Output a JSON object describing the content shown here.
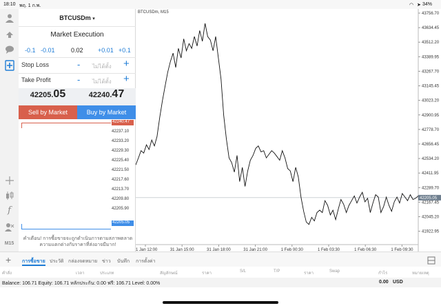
{
  "status_bar": {
    "time": "18:10",
    "date": "พฤ. 1 ก.พ.",
    "battery": "34%"
  },
  "toolbar": {
    "timeframe": "M15"
  },
  "order": {
    "symbol": "BTCUSDm",
    "symbol_caret": "▾",
    "execution": "Market Execution",
    "lot_steps": [
      "-0.1",
      "-0.01",
      "0.02",
      "+0.01",
      "+0.1"
    ],
    "stop_loss_label": "Stop Loss",
    "take_profit_label": "Take Profit",
    "not_set": "ไม่ได้ตั้ง",
    "minus": "-",
    "plus": "+",
    "bid_main": "42205.",
    "bid_big": "05",
    "ask_main": "42240.",
    "ask_big": "47",
    "sell_label": "Sell by Market",
    "buy_label": "Buy by Market",
    "ladder": [
      "42237.10",
      "42233.20",
      "42229.30",
      "42225.40",
      "42221.50",
      "42217.60",
      "42213.70",
      "42209.80",
      "42205.90"
    ],
    "ask_tag": "42240.47",
    "bid_tag": "42205.05",
    "warning_line1": "คำเตือน! การซื้อขายจะถูกดำเนินการตามสภาพตลาด",
    "warning_line2": "ความแตกต่างกับราคาที่ส่งอาจมีมาก!"
  },
  "chart_data": {
    "type": "line",
    "title": "BTCUSDm, M15",
    "xlabel": "",
    "ylabel": "",
    "x_ticks": [
      "31 Jan 12:00",
      "31 Jan 15:00",
      "31 Jan 18:00",
      "31 Jan 21:00",
      "1 Feb 00:30",
      "1 Feb 03:30",
      "1 Feb 06:30",
      "1 Feb 09:30"
    ],
    "y_ticks": [
      "43756.70",
      "43634.45",
      "43512.20",
      "43389.95",
      "43267.70",
      "43145.45",
      "43023.20",
      "42900.95",
      "42778.70",
      "42656.45",
      "42534.20",
      "42411.95",
      "42289.70",
      "42167.45",
      "42045.20",
      "41922.95"
    ],
    "ylim": [
      41880,
      43780
    ],
    "current_price": "42205.05",
    "values": [
      42480,
      42540,
      42600,
      42580,
      42650,
      42610,
      42690,
      42640,
      42720,
      42880,
      43020,
      43140,
      43260,
      43350,
      43420,
      43300,
      43460,
      43380,
      43540,
      43440,
      43500,
      43460,
      43560,
      43480,
      43610,
      43520,
      43670,
      43560,
      43530,
      43440,
      43560,
      43380,
      43200,
      42900,
      42700,
      42540,
      42500,
      42420,
      42560,
      42340,
      42460,
      42300,
      42430,
      42520,
      42560,
      42620,
      42640,
      42590,
      42600,
      42540,
      42570,
      42600,
      42580,
      42550,
      42520,
      42600,
      42540,
      42450,
      42430,
      42340,
      42460,
      42380,
      42210,
      42090,
      42000,
      41980,
      42040,
      42010,
      42080,
      42100,
      42080,
      42180,
      42140,
      42060,
      42100,
      42020,
      42110,
      42190,
      42150,
      42080,
      42140,
      42180,
      42220,
      42160,
      42210,
      42250,
      42170,
      42200,
      42080,
      42160,
      42230,
      42210,
      42080,
      42130,
      42210,
      42140,
      42090,
      42170,
      42210,
      42160,
      42240,
      42210,
      42180,
      42230,
      42190,
      42200,
      42220
    ]
  },
  "tabs": [
    "การซื้อขาย",
    "ประวัติ",
    "กล่องจดหมาย",
    "ข่าว",
    "บันทึก",
    "การตั้งค่า"
  ],
  "columns": [
    "คำสั่ง",
    "เวลา",
    "ประเภท",
    "สัญลักษณ์",
    "ราคา",
    "S/L",
    "T/P",
    "ราคา",
    "Swap",
    "กำไร",
    "หมายเหตุ"
  ],
  "balance": {
    "text": "Balance: 106.71 Equity: 106.71 หลักประกัน: 0.00 ฟรี: 106.71 Level: 0.00%",
    "profit": "0.00",
    "currency": "USD"
  }
}
